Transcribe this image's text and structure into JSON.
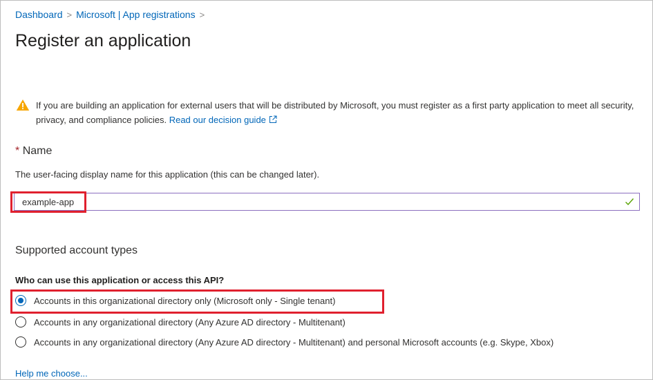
{
  "breadcrumb": {
    "items": [
      "Dashboard",
      "Microsoft | App registrations"
    ],
    "separator": ">"
  },
  "page": {
    "title": "Register an application"
  },
  "warning": {
    "text": "If you are building an application for external users that will be distributed by Microsoft, you must register as a first party application to meet all security, privacy, and compliance policies.",
    "link_label": "Read our decision guide",
    "icon": "warning-icon",
    "link_icon": "external-link-icon"
  },
  "name_field": {
    "required_marker": "*",
    "label": "Name",
    "description": "The user-facing display name for this application (this can be changed later).",
    "value": "example-app",
    "valid_icon": "checkmark-icon"
  },
  "account_types": {
    "section_title": "Supported account types",
    "question": "Who can use this application or access this API?",
    "options": [
      {
        "label": "Accounts in this organizational directory only (Microsoft only - Single tenant)",
        "selected": true
      },
      {
        "label": "Accounts in any organizational directory (Any Azure AD directory - Multitenant)",
        "selected": false
      },
      {
        "label": "Accounts in any organizational directory (Any Azure AD directory - Multitenant) and personal Microsoft accounts (e.g. Skype, Xbox)",
        "selected": false
      }
    ],
    "help_link": "Help me choose..."
  },
  "colors": {
    "link": "#0066b8",
    "highlight": "#e0202e",
    "warning": "#f7a600",
    "valid": "#57a300",
    "required": "#a4262c"
  }
}
